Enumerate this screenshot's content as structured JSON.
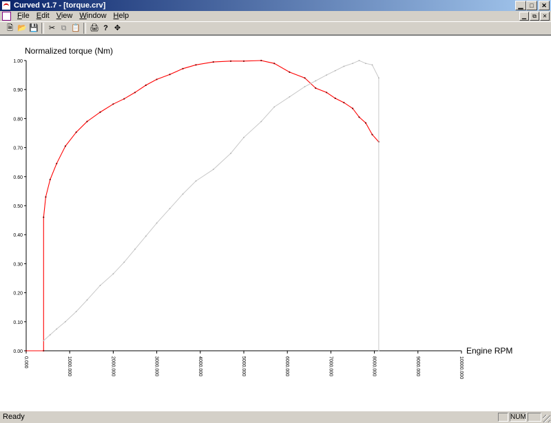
{
  "window": {
    "title": "Curved v1.7 - [torque.crv]"
  },
  "menu": {
    "items": [
      "File",
      "Edit",
      "View",
      "Window",
      "Help"
    ]
  },
  "toolbar": {
    "icons": [
      "new-icon",
      "open-icon",
      "save-icon",
      "cut-icon",
      "copy-icon",
      "paste-icon",
      "print-icon",
      "help-icon",
      "move-icon"
    ]
  },
  "status": {
    "text": "Ready",
    "num": "NUM"
  },
  "chart_data": {
    "type": "line",
    "ylabel": "Normalized torque (Nm)",
    "xlabel": "Engine RPM",
    "xlim": [
      0,
      10000
    ],
    "ylim": [
      0,
      1
    ],
    "xticks": [
      "0.000",
      "1000.000",
      "2000.000",
      "3000.000",
      "4000.000",
      "5000.000",
      "6000.000",
      "7000.000",
      "8000.000",
      "9000.000",
      "10000.000"
    ],
    "yticks": [
      "0.00",
      "0.10",
      "0.20",
      "0.30",
      "0.40",
      "0.50",
      "0.60",
      "0.70",
      "0.80",
      "0.90",
      "1.00"
    ],
    "grid": false,
    "colors": {
      "torque": "#ff0000",
      "power": "#c8c8c8"
    },
    "series": [
      {
        "x": [
          0,
          400,
          400,
          450,
          550,
          700,
          900,
          1150,
          1400,
          1700,
          2000,
          2250,
          2500,
          2750,
          3000,
          3300,
          3600,
          3900,
          4300,
          4700,
          5000,
          5400,
          5700,
          6050,
          6400,
          6650,
          6900,
          7100,
          7300,
          7500,
          7650,
          7800,
          7950,
          8100
        ],
        "y": [
          0,
          0,
          0.46,
          0.53,
          0.59,
          0.645,
          0.705,
          0.753,
          0.79,
          0.822,
          0.85,
          0.868,
          0.89,
          0.915,
          0.935,
          0.952,
          0.972,
          0.985,
          0.995,
          0.998,
          0.998,
          1.0,
          0.99,
          0.96,
          0.94,
          0.905,
          0.89,
          0.87,
          0.855,
          0.835,
          0.805,
          0.785,
          0.745,
          0.72
        ]
      },
      {
        "x": [
          400,
          550,
          700,
          900,
          1150,
          1400,
          1700,
          2000,
          2250,
          2500,
          2750,
          3000,
          3300,
          3600,
          3900,
          4300,
          4700,
          5000,
          5400,
          5700,
          6050,
          6400,
          6650,
          6900,
          7100,
          7300,
          7500,
          7650,
          7800,
          7950,
          8100,
          8100
        ],
        "y": [
          0.035,
          0.055,
          0.075,
          0.1,
          0.135,
          0.175,
          0.225,
          0.265,
          0.305,
          0.35,
          0.395,
          0.44,
          0.49,
          0.54,
          0.585,
          0.625,
          0.68,
          0.735,
          0.79,
          0.84,
          0.875,
          0.91,
          0.93,
          0.95,
          0.965,
          0.98,
          0.99,
          1.0,
          0.99,
          0.985,
          0.94,
          0.0
        ]
      }
    ]
  }
}
